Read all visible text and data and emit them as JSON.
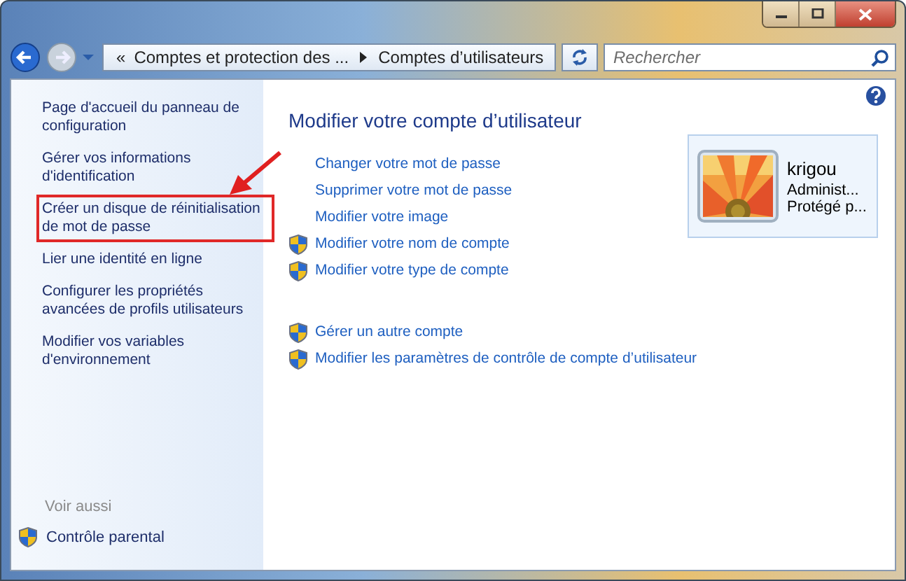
{
  "address_bar": {
    "overflow": "«",
    "crumbs": [
      "Comptes et protection des ...",
      "Comptes d’utilisateurs"
    ]
  },
  "search": {
    "placeholder": "Rechercher"
  },
  "sidebar": {
    "items": [
      {
        "label": "Page d'accueil du panneau de configuration",
        "highlighted": false
      },
      {
        "label": "Gérer vos informations d'identification",
        "highlighted": false
      },
      {
        "label": "Créer un disque de réinitialisation de mot de passe",
        "highlighted": true
      },
      {
        "label": "Lier une identité en ligne",
        "highlighted": false
      },
      {
        "label": "Configurer les propriétés avancées de profils utilisateurs",
        "highlighted": false
      },
      {
        "label": "Modifier vos variables d'environnement",
        "highlighted": false
      }
    ],
    "see_also": {
      "heading": "Voir aussi",
      "items": [
        {
          "label": "Contrôle parental",
          "shield": true
        }
      ]
    }
  },
  "main": {
    "title": "Modifier votre compte d’utilisateur",
    "link_groups": [
      [
        {
          "label": "Changer votre mot de passe",
          "shield": false
        },
        {
          "label": "Supprimer votre mot de passe",
          "shield": false
        },
        {
          "label": "Modifier votre image",
          "shield": false
        },
        {
          "label": "Modifier votre nom de compte",
          "shield": true
        },
        {
          "label": "Modifier votre type de compte",
          "shield": true
        }
      ],
      [
        {
          "label": "Gérer un autre compte",
          "shield": true
        },
        {
          "label": "Modifier les paramètres de contrôle de compte d’utilisateur",
          "shield": true
        }
      ]
    ],
    "user": {
      "name": "krigou",
      "type": "Administ...",
      "status": "Protégé p..."
    }
  }
}
